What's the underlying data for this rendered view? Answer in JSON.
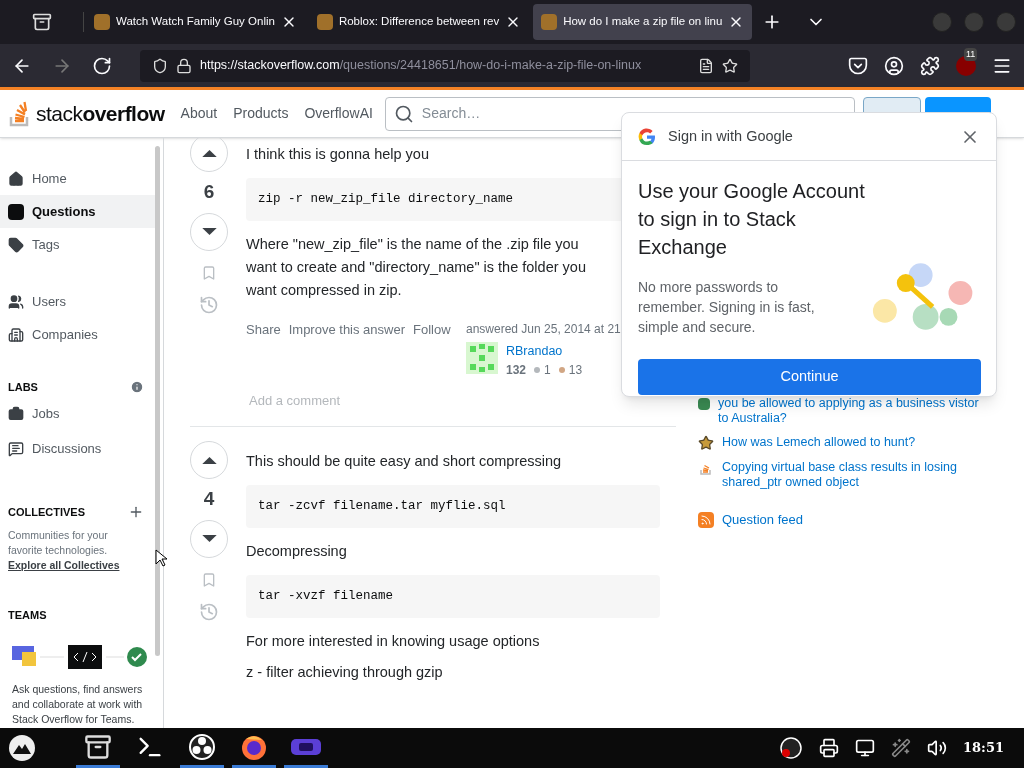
{
  "browser": {
    "tabs": [
      {
        "title": "Watch Watch Family Guy Onlin",
        "selected": false
      },
      {
        "title": "Roblox: Difference between rev",
        "selected": false
      },
      {
        "title": "How do I make a zip file on linu",
        "selected": true
      }
    ],
    "url": {
      "host": "https://stackoverflow.com",
      "path": "/questions/24418651/how-do-i-make-a-zip-file-on-linux"
    },
    "extension_badge": "11"
  },
  "header": {
    "logo_light": "stack",
    "logo_bold": "overflow",
    "nav": [
      "About",
      "Products",
      "OverflowAI"
    ],
    "search_placeholder": "Search…"
  },
  "sidebar": {
    "items": [
      {
        "label": "Home",
        "selected": false
      },
      {
        "label": "Questions",
        "selected": true
      },
      {
        "label": "Tags",
        "selected": false
      },
      {
        "label": "Users",
        "selected": false
      },
      {
        "label": "Companies",
        "selected": false
      }
    ],
    "labs": {
      "title": "LABS",
      "items": [
        "Jobs",
        "Discussions"
      ]
    },
    "collectives": {
      "title": "COLLECTIVES",
      "text": "Communities for your favorite technologies.",
      "link": "Explore all Collectives"
    },
    "teams": {
      "title": "TEAMS",
      "text": "Ask questions, find answers and collaborate at work with Stack Overflow for Teams."
    }
  },
  "answers": [
    {
      "votes": "6",
      "blocks": [
        {
          "kind": "text",
          "text": "I think this is gonna help you"
        },
        {
          "kind": "code",
          "text": "zip -r new_zip_file directory_name"
        },
        {
          "kind": "text",
          "text": "Where \"new_zip_file\" is the name of the .zip file you want to create and \"directory_name\" is the folder you want compressed in zip."
        }
      ],
      "actions": [
        "Share",
        "Improve this answer",
        "Follow"
      ],
      "answered": "answered Jun 25, 2014 at 21",
      "user": "RBrandao",
      "reputation": "132",
      "silver": "1",
      "bronze": "13",
      "comment": "Add a comment"
    },
    {
      "votes": "4",
      "blocks": [
        {
          "kind": "text",
          "text": "This should be quite easy and short compressing"
        },
        {
          "kind": "code",
          "text": "tar -zcvf filename.tar myflie.sql"
        },
        {
          "kind": "text",
          "text": "Decompressing"
        },
        {
          "kind": "code",
          "text": "tar -xvzf filename"
        },
        {
          "kind": "text",
          "text": "For more interested in knowing usage options"
        },
        {
          "kind": "text",
          "text": "z - filter achieving through gzip"
        }
      ]
    }
  ],
  "hot_questions": [
    "you be allowed to applying as a business vistor to Australia?",
    "How was Lemech allowed to hunt?",
    "Copying virtual base class results in losing shared_ptr owned object"
  ],
  "question_feed": "Question feed",
  "google_popup": {
    "title": "Sign in with Google",
    "heading": "Use your Google Account to sign in to Stack Exchange",
    "text": "No more passwords to remember. Signing in is fast, simple and secure.",
    "button": "Continue"
  },
  "taskbar": {
    "apps": [
      {
        "active": true
      },
      {
        "active": false
      },
      {
        "active": true
      },
      {
        "active": true
      },
      {
        "active": true
      }
    ],
    "clock": "18:51"
  }
}
